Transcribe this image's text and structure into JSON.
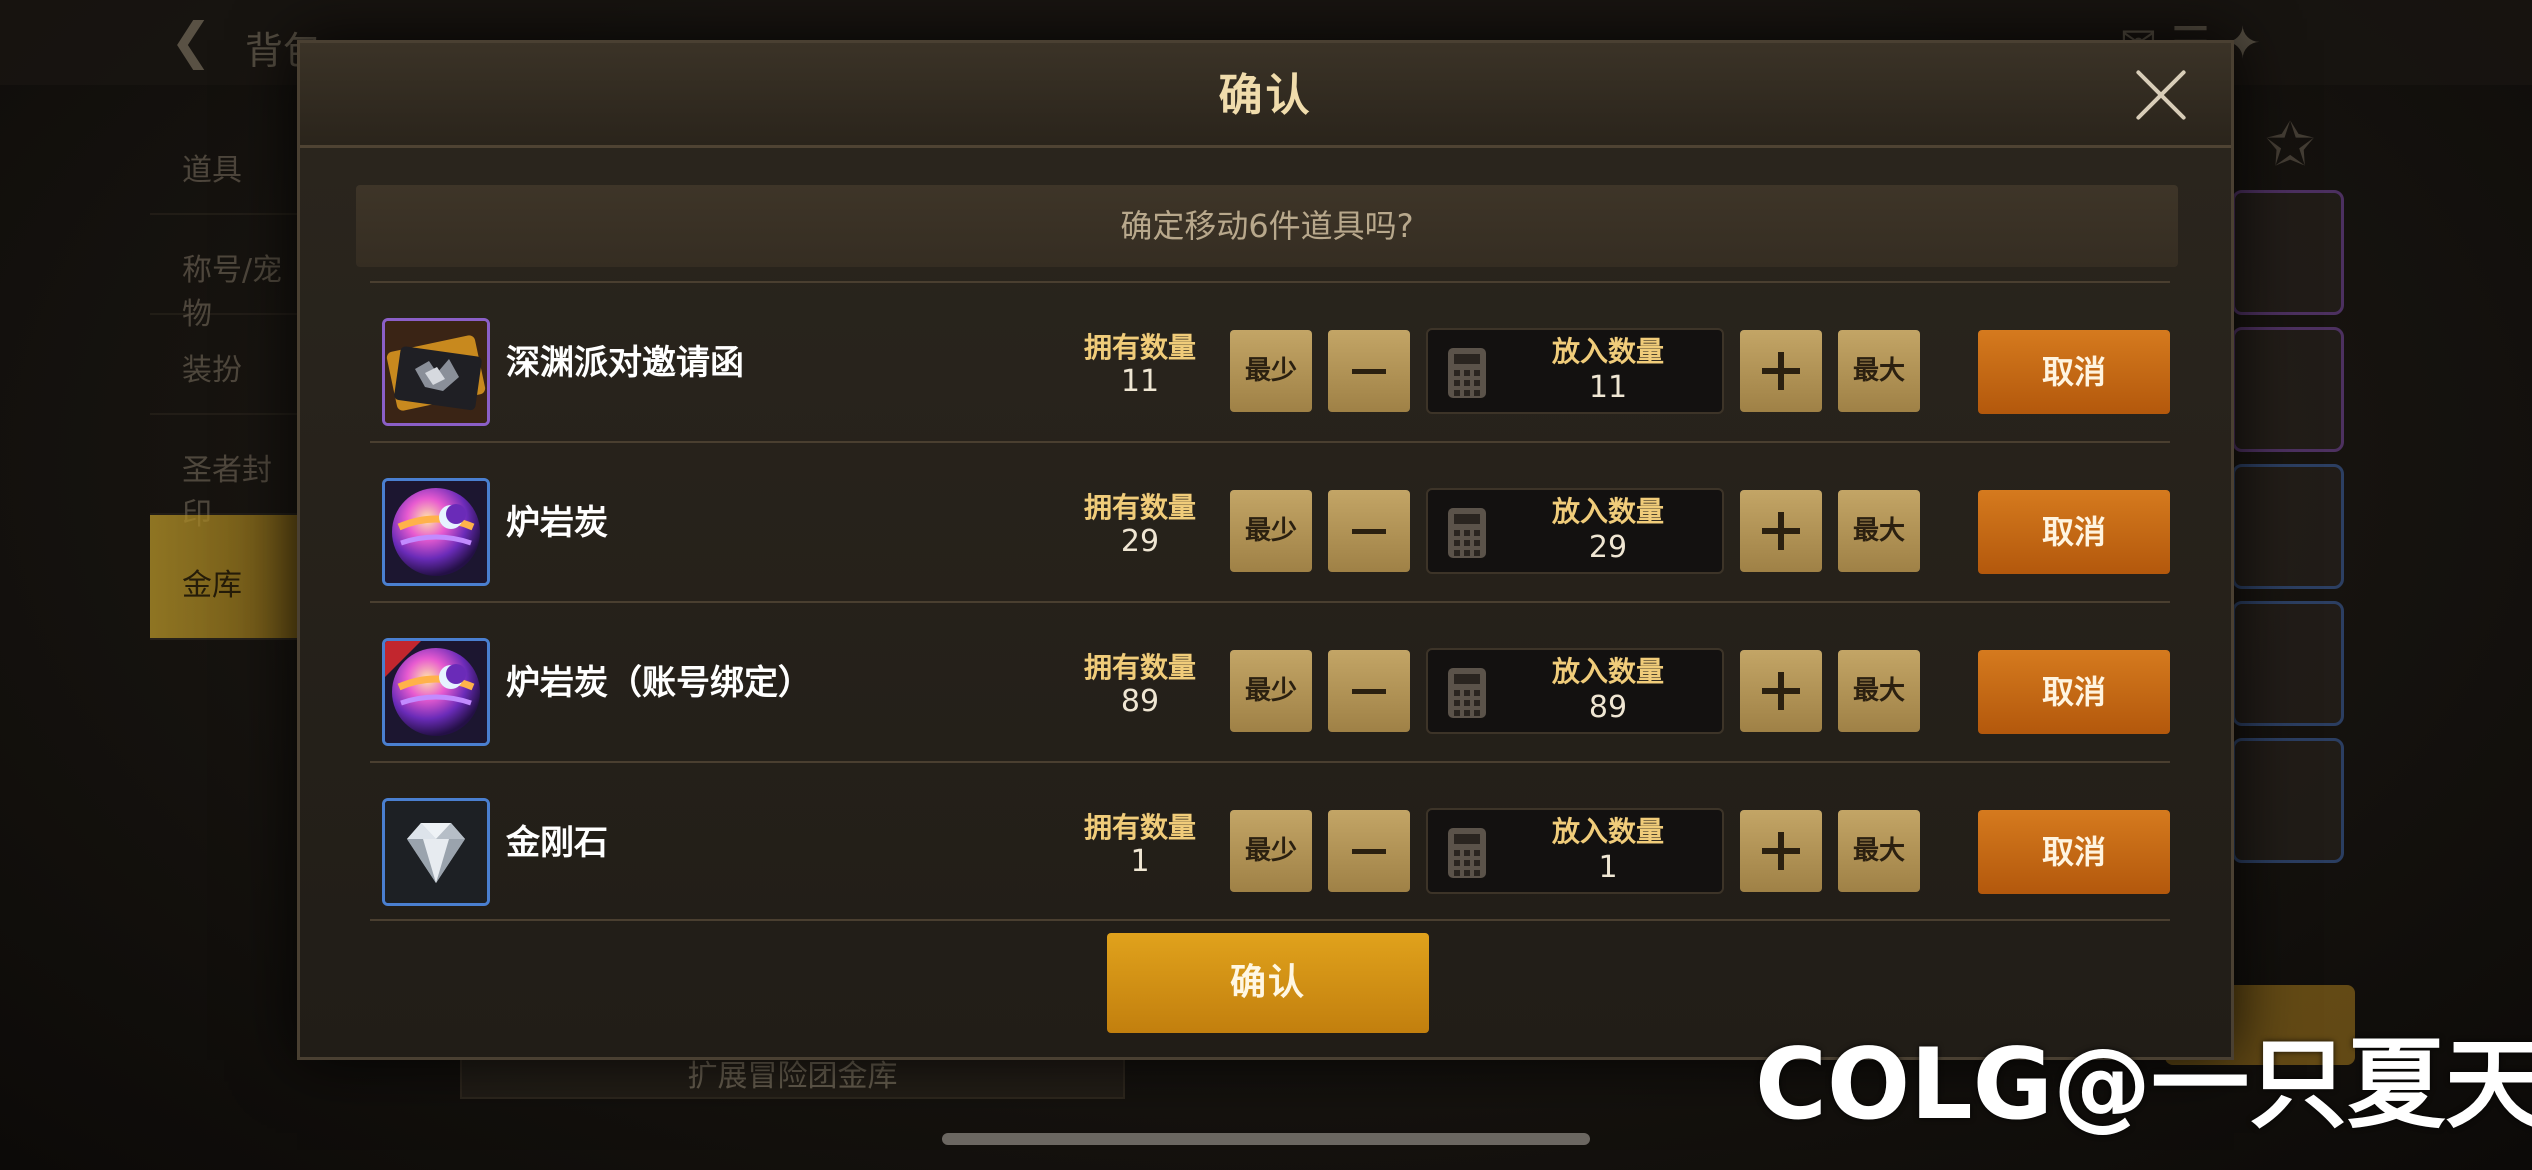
{
  "background": {
    "screen_title": "背包",
    "sidebar_items": [
      "道具",
      "称号/宠物",
      "装扮",
      "圣者封印",
      "金库"
    ],
    "bottom_bar": "扩展冒险团金库"
  },
  "dialog": {
    "title": "确认",
    "prompt": "确定移动6件道具吗?",
    "confirm_label": "确认",
    "owned_label": "拥有数量",
    "put_label": "放入数量",
    "min_label": "最少",
    "max_label": "最大",
    "cancel_label": "取消",
    "items": [
      {
        "name": "深渊派对邀请函",
        "owned": "11",
        "put": "11",
        "rarity": "purple",
        "icon": "invitation-card-icon"
      },
      {
        "name": "炉岩炭",
        "owned": "29",
        "put": "29",
        "rarity": "blue",
        "icon": "orb-icon"
      },
      {
        "name": "炉岩炭（账号绑定）",
        "owned": "89",
        "put": "89",
        "rarity": "blue",
        "icon": "orb-bound-icon",
        "badge": "账号"
      },
      {
        "name": "金刚石",
        "owned": "1",
        "put": "1",
        "rarity": "blue",
        "icon": "diamond-icon"
      }
    ]
  },
  "watermark": "COLG@一只夏天",
  "colors": {
    "accent_gold": "#c3a566",
    "cancel_orange": "#c9690f",
    "confirm_gold": "#d5930f",
    "title_text": "#f0dcac"
  }
}
